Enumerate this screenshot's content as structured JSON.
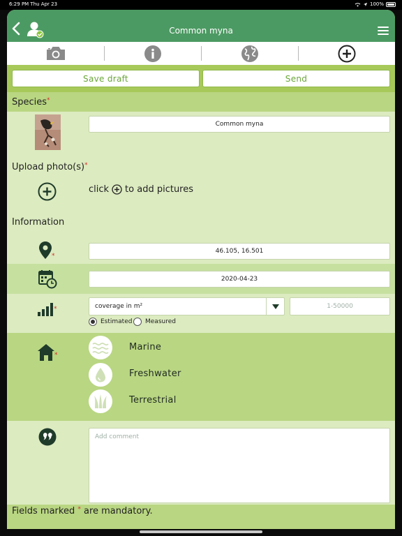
{
  "status_bar": {
    "time": "6:29 PM  Thu Apr 23",
    "battery": "100%"
  },
  "header": {
    "title": "Common myna"
  },
  "tabs": [
    {
      "name": "camera-icon"
    },
    {
      "name": "info-icon"
    },
    {
      "name": "globe-icon"
    },
    {
      "name": "add-circle-icon"
    }
  ],
  "actions": {
    "save_label": "Save draft",
    "send_label": "Send"
  },
  "species": {
    "label": "Species",
    "required": "*",
    "value": "Common myna"
  },
  "upload": {
    "label": "Upload photo(s)",
    "required": "*",
    "hint_prefix": "click",
    "hint_suffix": "to add pictures"
  },
  "information": {
    "label": "Information"
  },
  "location": {
    "value": "46.105, 16.501",
    "required": "*"
  },
  "date": {
    "value": "2020-04-23"
  },
  "abundance": {
    "required": "*",
    "select_value": "coverage in m²",
    "number_placeholder": "1-50000",
    "estimated_label": "Estimated",
    "measured_label": "Measured",
    "selected": "Estimated"
  },
  "habitat": {
    "required": "*",
    "options": [
      {
        "label": "Marine",
        "icon": "waves-icon"
      },
      {
        "label": "Freshwater",
        "icon": "water-drop-icon"
      },
      {
        "label": "Terrestrial",
        "icon": "grass-icon"
      }
    ]
  },
  "comment": {
    "placeholder": "Add comment"
  },
  "footer": {
    "before": "Fields marked",
    "star": "*",
    "after": "are mandatory."
  },
  "colors": {
    "header": "#4c9a63",
    "accent": "#a7c95a",
    "background": "#dcebc0",
    "required": "#d42b2b"
  }
}
